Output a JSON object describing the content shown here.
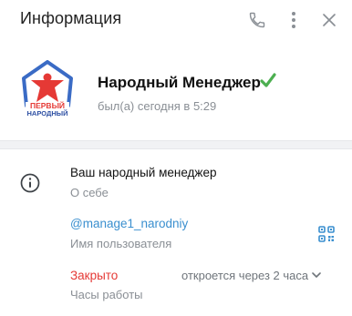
{
  "header": {
    "title": "Информация",
    "icons": [
      "phone-icon",
      "more-vertical-icon",
      "close-icon"
    ]
  },
  "profile": {
    "name": "Народный Менеджер",
    "status": "был(а) сегодня в 5:29",
    "avatar": {
      "logo_text_line1": "ПЕРВЫЙ",
      "logo_text_line2": "НАРОДНЫЙ"
    },
    "verified_icon": "checkmark-icon"
  },
  "info": {
    "about": {
      "icon": "info-icon",
      "value": "Ваш народный менеджер",
      "label": "О себе"
    },
    "username": {
      "value": "@manage1_narodniy",
      "label": "Имя пользователя",
      "icon": "qr-code-icon"
    },
    "hours": {
      "status": "Закрыто",
      "next": "откроется через 2 часа",
      "label": "Часы работы"
    }
  },
  "colors": {
    "accent": "#3a8fcf",
    "closed": "#e53935",
    "verified": "#4caf50",
    "secondary_text": "#8a8f95"
  }
}
